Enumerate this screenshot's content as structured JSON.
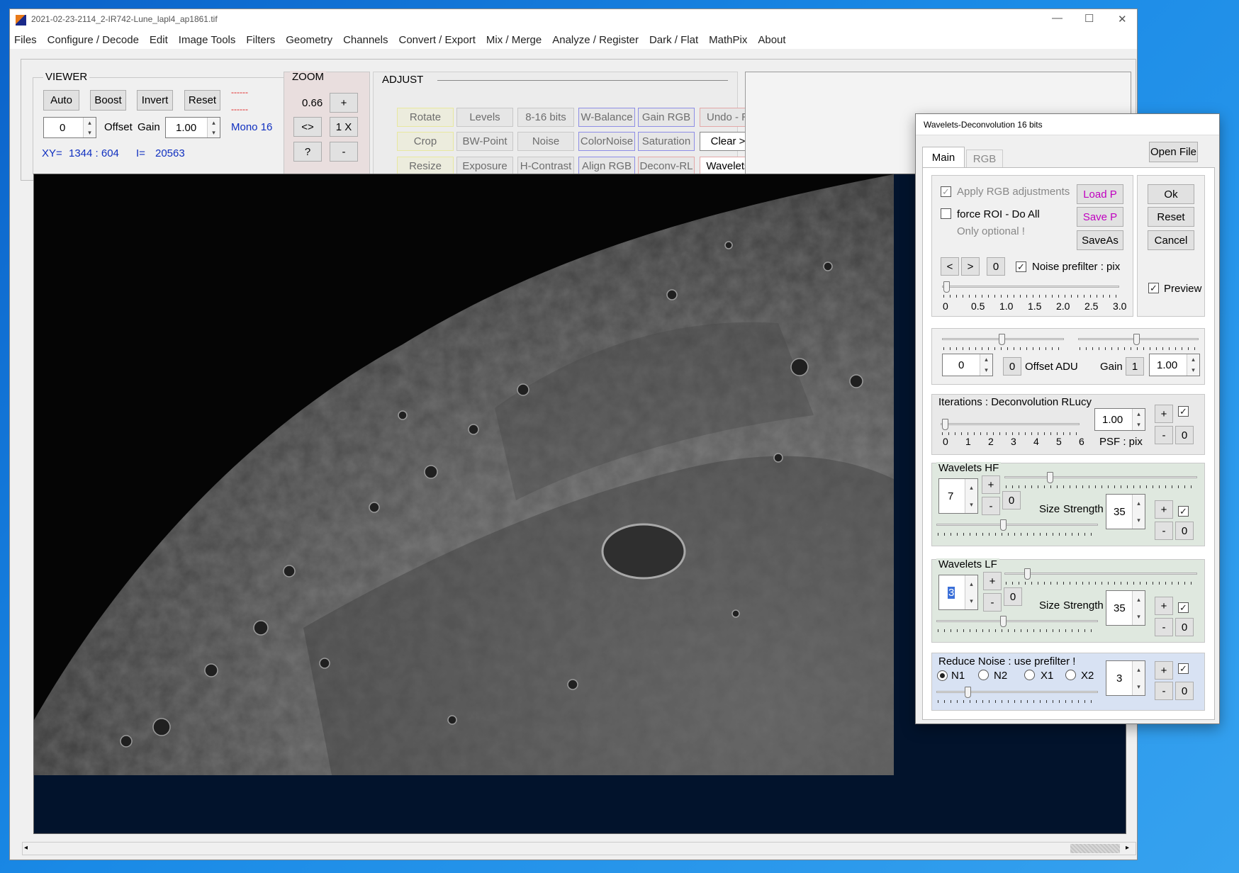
{
  "window": {
    "title": "2021-02-23-2114_2-IR742-Lune_lapl4_ap1861.tif",
    "min": "—",
    "max": "☐",
    "close": "✕"
  },
  "menu": [
    "Files",
    "Configure / Decode",
    "Edit",
    "Image Tools",
    "Filters",
    "Geometry",
    "Channels",
    "Convert / Export",
    "Mix / Merge",
    "Analyze / Register",
    "Dark / Flat",
    "MathPix",
    "About"
  ],
  "viewer": {
    "title": "VIEWER",
    "auto": "Auto",
    "boost": "Boost",
    "invert": "Invert",
    "reset": "Reset",
    "dash1": "------",
    "dash2": "------",
    "offset_value": "0",
    "offset_label": "Offset",
    "gain_label": "Gain",
    "gain_value": "1.00",
    "mode": "Mono 16",
    "xy_label": "XY=",
    "xy_value": "1344 : 604",
    "i_label": "I=",
    "i_value": "20563"
  },
  "zoom": {
    "title": "ZOOM",
    "value": "0.66",
    "plus": "+",
    "fit": "<>",
    "one": "1 X",
    "help": "?",
    "minus": "-"
  },
  "adjust": {
    "title": "ADJUST",
    "row1": [
      "Rotate",
      "Levels",
      "8-16 bits",
      "W-Balance",
      "Gain RGB",
      "Undo - R"
    ],
    "row2": [
      "Crop",
      "BW-Point",
      "Noise",
      "ColorNoise",
      "Saturation",
      "Clear >"
    ],
    "row3": [
      "Resize",
      "Exposure",
      "H-Contrast",
      "Align RGB",
      "Deconv-RL",
      "Wavelets"
    ]
  },
  "dialog": {
    "title": "Wavelets-Deconvolution 16 bits",
    "tabs": [
      "Main",
      "RGB"
    ],
    "open_file": "Open File",
    "apply_rgb": "Apply RGB adjustments",
    "force_roi": "force ROI - Do All",
    "only_optional": "Only optional !",
    "load_p": "Load P",
    "save_p": "Save P",
    "save_as": "SaveAs",
    "ok": "Ok",
    "reset": "Reset",
    "cancel": "Cancel",
    "preview": "Preview",
    "prev": "<",
    "next": ">",
    "zero": "0",
    "noise_prefilter": "Noise prefilter : pix",
    "scale": [
      "0",
      "0.5",
      "1.0",
      "1.5",
      "2.0",
      "2.5",
      "3.0"
    ],
    "offset_value": "0",
    "offset_zero": "0",
    "offset_adu": "Offset ADU",
    "gain_label": "Gain",
    "gain_one": "1",
    "gain_value": "1.00",
    "iter_title": "Iterations : Deconvolution RLucy",
    "iter_value": "1.00",
    "iter_scale": [
      "0",
      "1",
      "2",
      "3",
      "4",
      "5",
      "6"
    ],
    "psf": "PSF : pix",
    "hf_title": "Wavelets HF",
    "hf_size": "7",
    "hf_strength": "35",
    "lf_title": "Wavelets LF",
    "lf_size": "3",
    "lf_strength": "35",
    "size_label": "Size",
    "strength_label": "Strength",
    "noise_title": "Reduce Noise : use prefilter !",
    "n1": "N1",
    "n2": "N2",
    "x1": "X1",
    "x2": "X2",
    "noise_value": "3",
    "plus": "+",
    "minus": "-",
    "check": "✓"
  },
  "colors": {
    "accent_magenta": "#c000c0",
    "blue_text": "#1030c0",
    "red_text": "#e02020"
  }
}
